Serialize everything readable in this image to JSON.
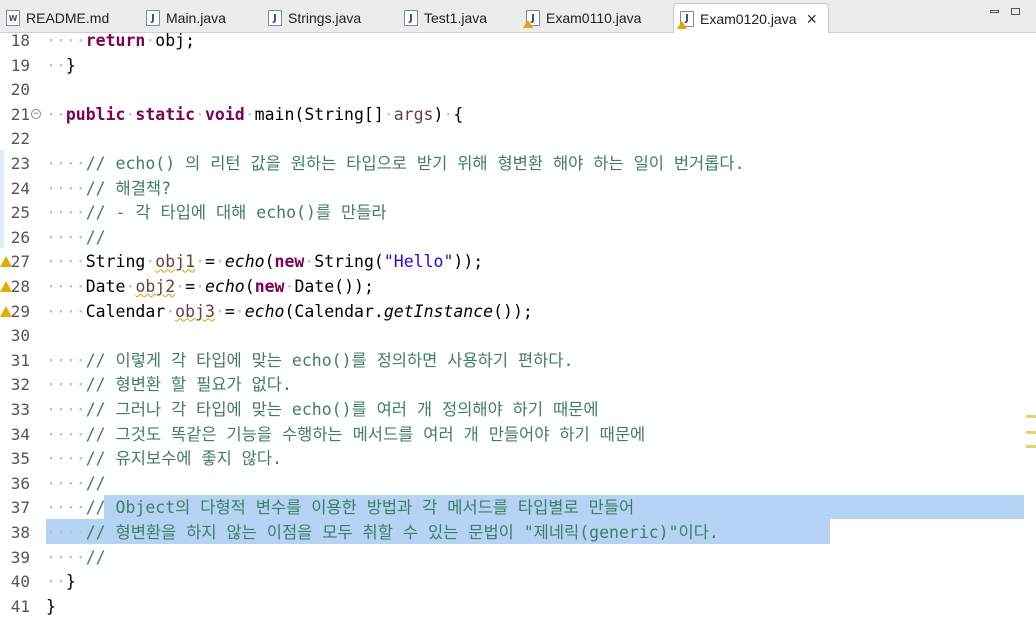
{
  "tabs": [
    {
      "label": "README.md",
      "icon": "markdown-file-icon",
      "icon_glyph": "W",
      "active": false,
      "warning": false
    },
    {
      "label": "Main.java",
      "icon": "java-file-icon",
      "icon_glyph": "J",
      "active": false,
      "warning": false
    },
    {
      "label": "Strings.java",
      "icon": "java-file-icon",
      "icon_glyph": "J",
      "active": false,
      "warning": false
    },
    {
      "label": "Test1.java",
      "icon": "java-file-icon",
      "icon_glyph": "J",
      "active": false,
      "warning": false
    },
    {
      "label": "Exam0110.java",
      "icon": "java-file-warning-icon",
      "icon_glyph": "J",
      "active": false,
      "warning": true
    },
    {
      "label": "Exam0120.java",
      "icon": "java-file-warning-icon",
      "icon_glyph": "J",
      "active": true,
      "warning": true,
      "close": "×"
    }
  ],
  "window": {
    "minimize": "minimize-icon",
    "maximize": "maximize-icon"
  },
  "editor": {
    "lines": [
      {
        "num": "18",
        "text": "return obj;"
      },
      {
        "num": "19",
        "text": "}"
      },
      {
        "num": "20",
        "text": ""
      },
      {
        "num": "21",
        "text": "public static void main(String[] args) {"
      },
      {
        "num": "22",
        "text": ""
      },
      {
        "num": "23",
        "text": "// echo() 의 리턴 값을 원하는 타입으로 받기 위해 형변환 해야 하는 일이 번거롭다."
      },
      {
        "num": "24",
        "text": "// 해결책?"
      },
      {
        "num": "25",
        "text": "// - 각 타입에 대해 echo()를 만들라"
      },
      {
        "num": "26",
        "text": "//"
      },
      {
        "num": "27",
        "text": "String obj1 = echo(new String(\"Hello\"));"
      },
      {
        "num": "28",
        "text": "Date obj2 = echo(new Date());"
      },
      {
        "num": "29",
        "text": "Calendar obj3 = echo(Calendar.getInstance());"
      },
      {
        "num": "30",
        "text": ""
      },
      {
        "num": "31",
        "text": "// 이렇게 각 타입에 맞는 echo()를 정의하면 사용하기 편하다."
      },
      {
        "num": "32",
        "text": "// 형변환 할 필요가 없다."
      },
      {
        "num": "33",
        "text": "// 그러나 각 타입에 맞는 echo()를 여러 개 정의해야 하기 때문에"
      },
      {
        "num": "34",
        "text": "// 그것도 똑같은 기능을 수행하는 메서드를 여러 개 만들어야 하기 때문에"
      },
      {
        "num": "35",
        "text": "// 유지보수에 좋지 않다."
      },
      {
        "num": "36",
        "text": "//"
      },
      {
        "num": "37",
        "text": "// Object의 다형적 변수를 이용한 방법과 각 메서드를 타입별로 만들어"
      },
      {
        "num": "38",
        "text": "// 형변환을 하지 않는 이점을 모두 취할 수 있는 문법이 \"제네릭(generic)\"이다."
      },
      {
        "num": "39",
        "text": "//"
      },
      {
        "num": "40",
        "text": "}"
      },
      {
        "num": "41",
        "text": "}"
      }
    ]
  },
  "colors": {
    "keyword": "#7f0055",
    "comment": "#3f7f5f",
    "string": "#2a00ff",
    "selection": "#b4d3f5",
    "warning": "#e3ad00"
  }
}
